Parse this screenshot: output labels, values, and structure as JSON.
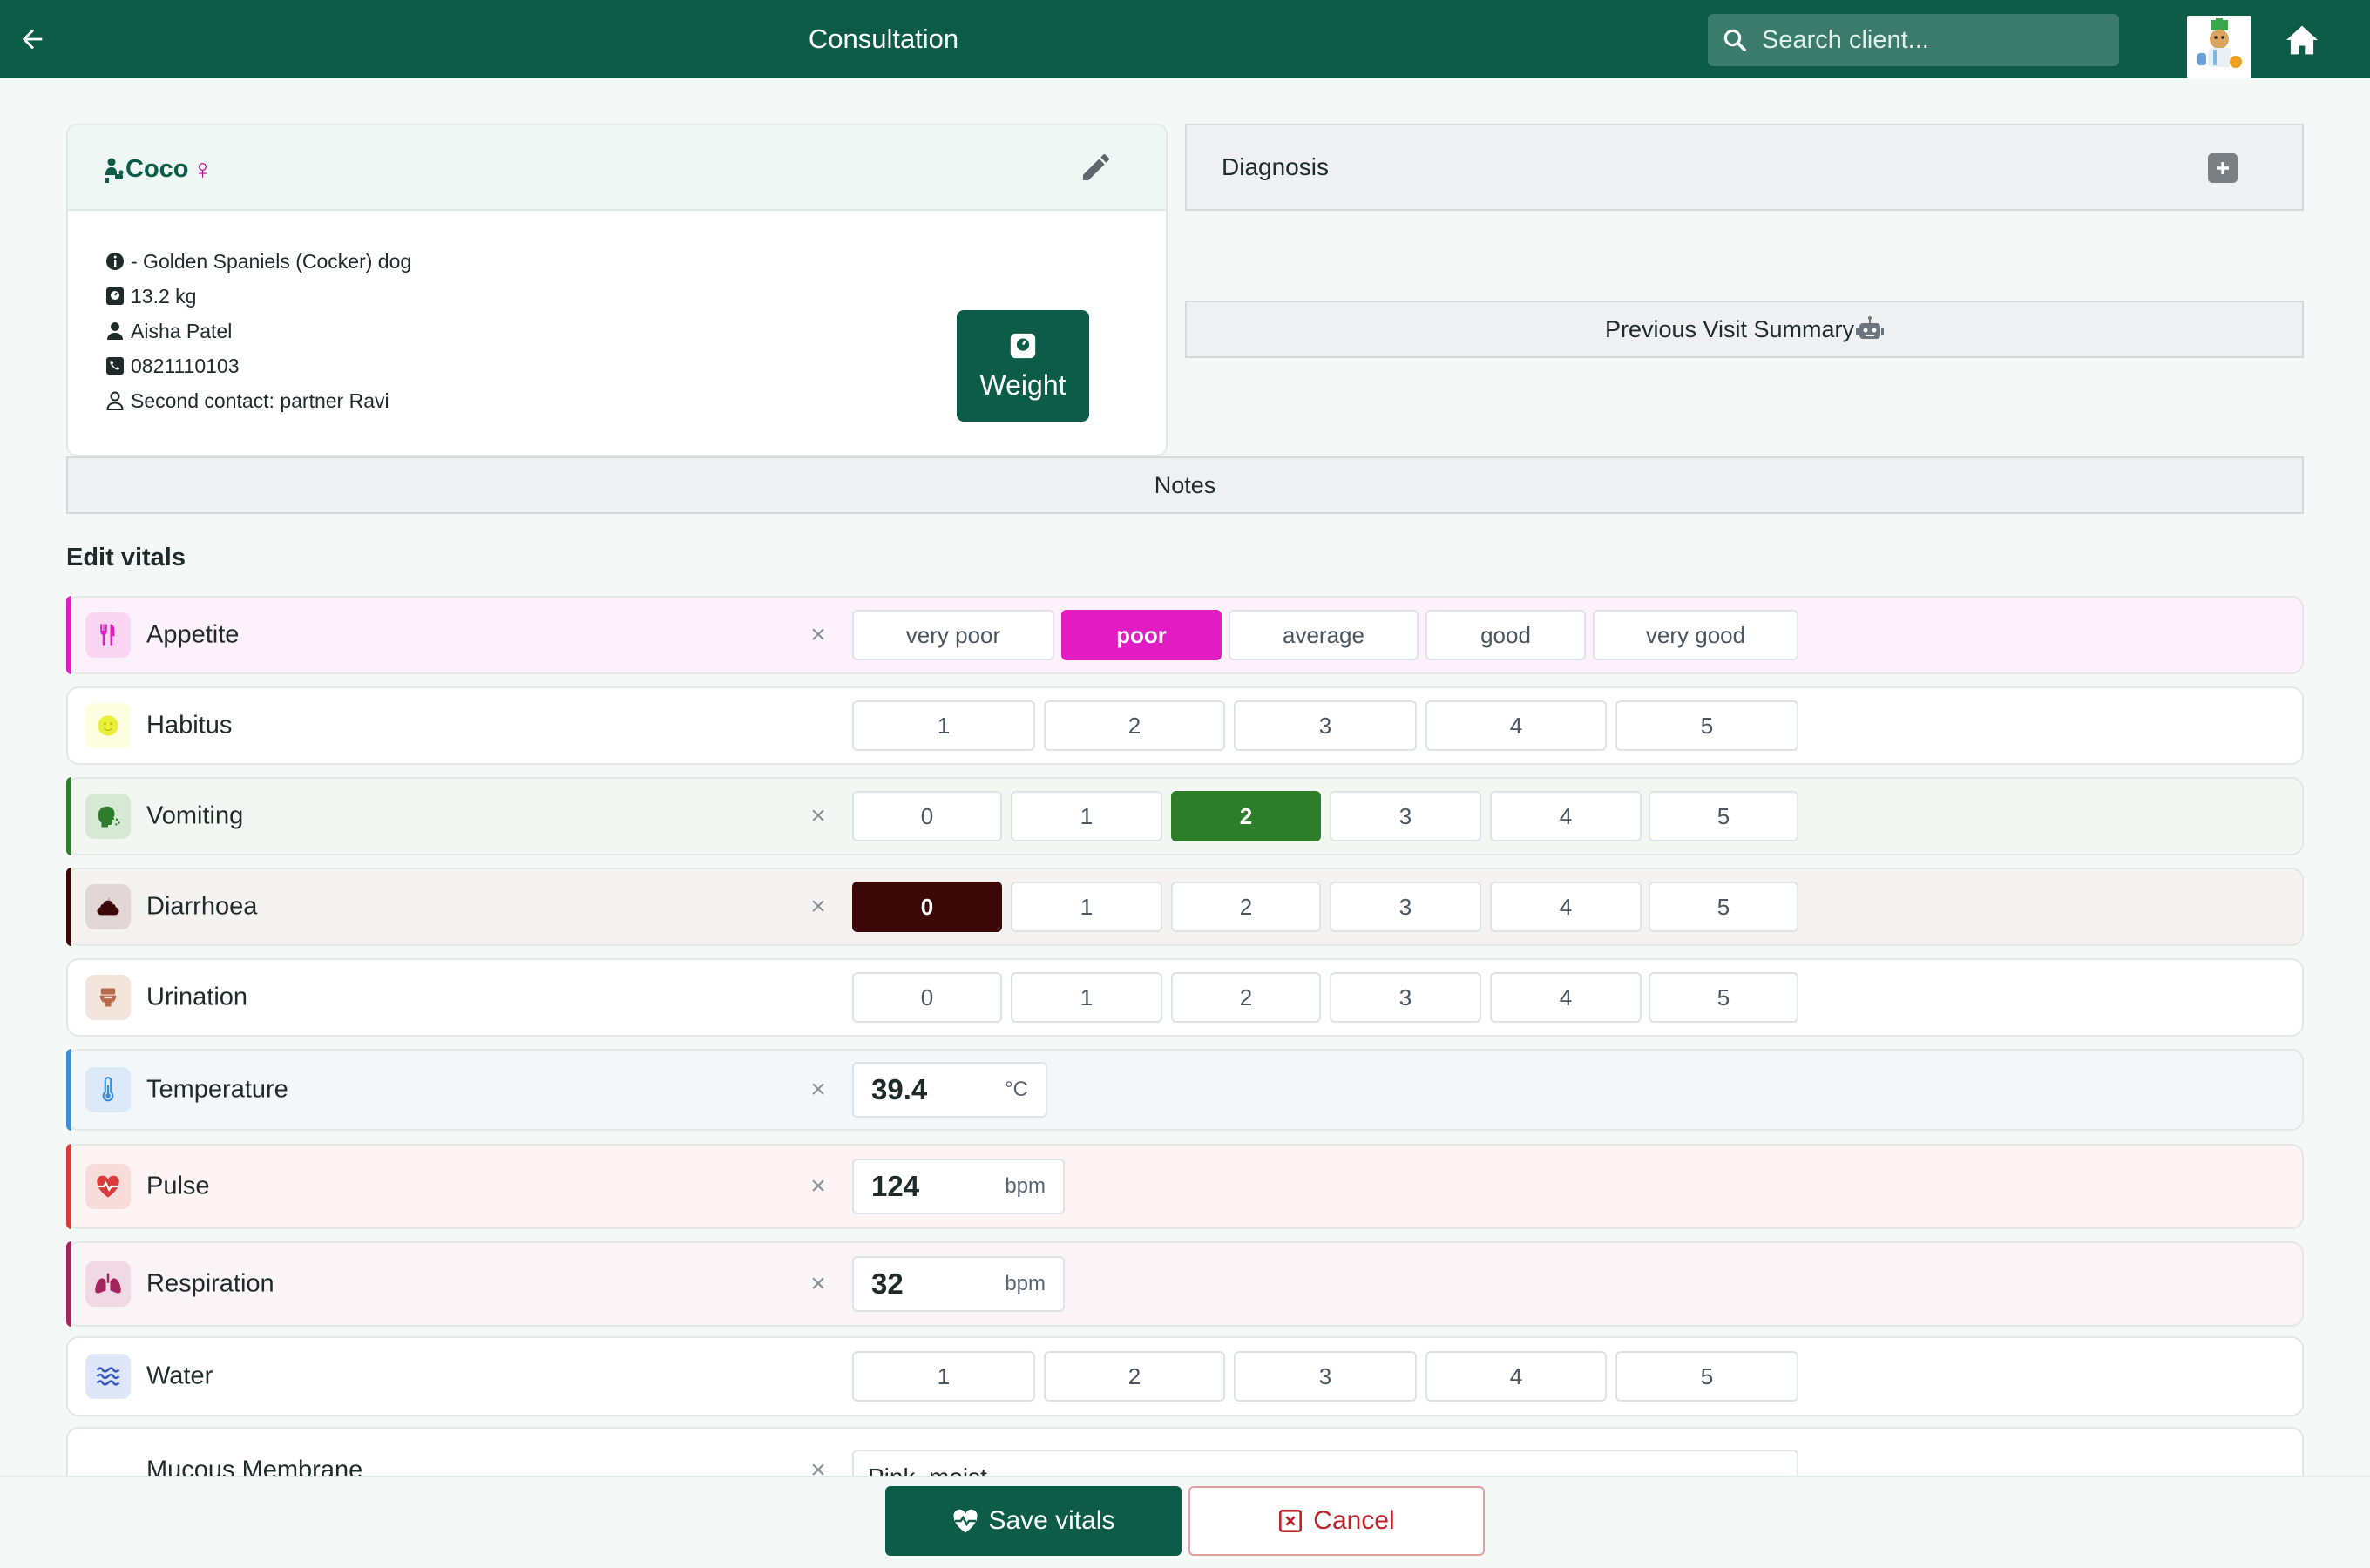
{
  "header": {
    "title": "Consultation",
    "search_placeholder": "Search client..."
  },
  "pet": {
    "name": "Coco",
    "sex_symbol": "♀",
    "breed": "- Golden Spaniels (Cocker) dog",
    "weight": "13.2 kg",
    "owner": "Aisha Patel",
    "phone": "0821110103",
    "second_contact": "Second contact: partner Ravi",
    "weight_button": "Weight"
  },
  "panels": {
    "diagnosis": "Diagnosis",
    "previous_visit": "Previous Visit Summary",
    "notes": "Notes"
  },
  "vitals_title": "Edit vitals",
  "vitals": {
    "appetite": {
      "label": "Appetite",
      "options": [
        "very poor",
        "poor",
        "average",
        "good",
        "very good"
      ],
      "selected": "poor",
      "color": "#e01cc2"
    },
    "habitus": {
      "label": "Habitus",
      "options": [
        "1",
        "2",
        "3",
        "4",
        "5"
      ],
      "selected": null
    },
    "vomiting": {
      "label": "Vomiting",
      "options": [
        "0",
        "1",
        "2",
        "3",
        "4",
        "5"
      ],
      "selected": "2",
      "color": "#2e7d2a"
    },
    "diarrhoea": {
      "label": "Diarrhoea",
      "options": [
        "0",
        "1",
        "2",
        "3",
        "4",
        "5"
      ],
      "selected": "0",
      "color": "#3b0707"
    },
    "urination": {
      "label": "Urination",
      "options": [
        "0",
        "1",
        "2",
        "3",
        "4",
        "5"
      ],
      "selected": null
    },
    "temperature": {
      "label": "Temperature",
      "value": "39.4",
      "unit": "°C"
    },
    "pulse": {
      "label": "Pulse",
      "value": "124",
      "unit": "bpm"
    },
    "respiration": {
      "label": "Respiration",
      "value": "32",
      "unit": "bpm"
    },
    "water": {
      "label": "Water",
      "options": [
        "1",
        "2",
        "3",
        "4",
        "5"
      ],
      "selected": null
    },
    "mucous": {
      "label": "Mucous Membrane",
      "value": "Pink, moist"
    }
  },
  "footer": {
    "save": "Save vitals",
    "cancel": "Cancel"
  }
}
